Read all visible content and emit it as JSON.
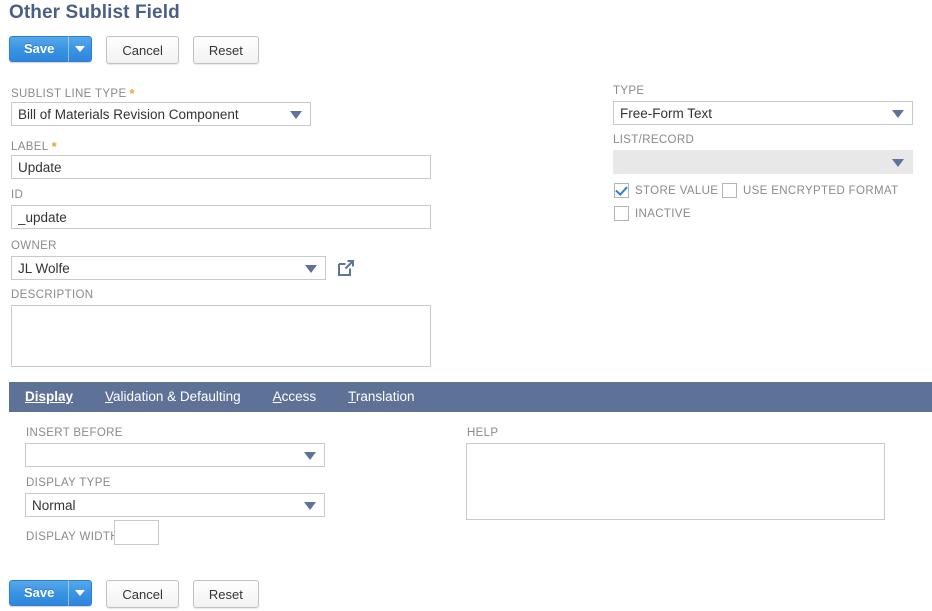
{
  "page": {
    "title": "Other Sublist Field"
  },
  "toolbar": {
    "save_label": "Save",
    "save_dropdown_icon": "caret-down-icon",
    "cancel_label": "Cancel",
    "reset_label": "Reset"
  },
  "form": {
    "left": {
      "sublist_line_type": {
        "label": "SUBLIST LINE TYPE",
        "required": "*",
        "value": "Bill of Materials Revision Component"
      },
      "field_label": {
        "label": "LABEL",
        "required": "*",
        "value": "Update"
      },
      "id": {
        "label": "ID",
        "value": "_update"
      },
      "owner": {
        "label": "OWNER",
        "value": "JL Wolfe",
        "popup_icon": "open-in-new-window-icon"
      },
      "description": {
        "label": "DESCRIPTION",
        "value": ""
      }
    },
    "right": {
      "type": {
        "label": "TYPE",
        "value": "Free-Form Text"
      },
      "list_record": {
        "label": "LIST/RECORD",
        "value": ""
      },
      "checkboxes": [
        {
          "label": "STORE VALUE",
          "checked": true
        },
        {
          "label": "USE ENCRYPTED FORMAT",
          "checked": false
        },
        {
          "label": "INACTIVE",
          "checked": false
        }
      ]
    }
  },
  "tabs": [
    {
      "label": "Display",
      "accel": "D",
      "active": true
    },
    {
      "label": "Validation & Defaulting",
      "accel": "V",
      "active": false
    },
    {
      "label": "Access",
      "accel": "A",
      "active": false
    },
    {
      "label": "Translation",
      "accel": "T",
      "active": false
    }
  ],
  "display_tab": {
    "insert_before": {
      "label": "INSERT BEFORE",
      "value": ""
    },
    "display_type": {
      "label": "DISPLAY TYPE",
      "value": "Normal"
    },
    "display_width": {
      "label": "DISPLAY WIDTH",
      "value": ""
    },
    "help": {
      "label": "HELP",
      "value": ""
    }
  },
  "colors": {
    "title": "#4a5f86",
    "primary_button": "#3a93e3",
    "tabbar": "#5e7298",
    "required_star": "#e8a33d",
    "label_text": "#8a8a8a",
    "checkmark": "#2f7fd0"
  }
}
